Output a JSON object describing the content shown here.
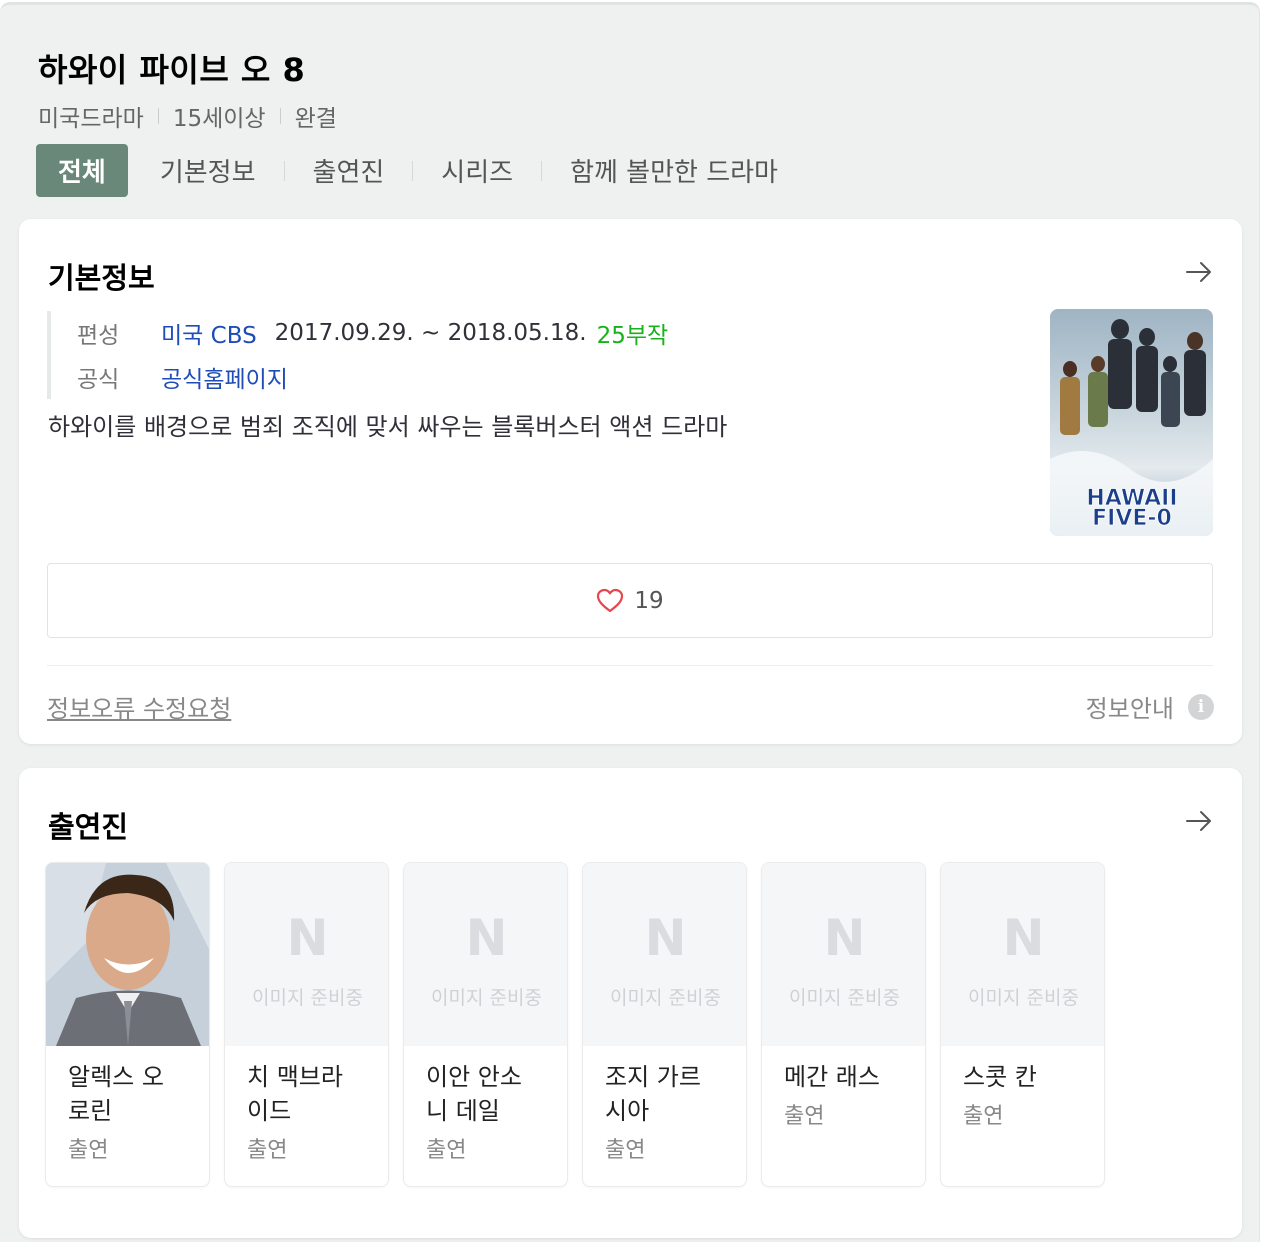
{
  "header": {
    "title": "하와이 파이브 오 8",
    "meta": [
      "미국드라마",
      "15세이상",
      "완결"
    ]
  },
  "tabs": [
    {
      "label": "전체",
      "active": true
    },
    {
      "label": "기본정보",
      "active": false
    },
    {
      "label": "출연진",
      "active": false
    },
    {
      "label": "시리즈",
      "active": false
    },
    {
      "label": "함께 볼만한 드라마",
      "active": false
    }
  ],
  "basic_info": {
    "title": "기본정보",
    "broadcast_label": "편성",
    "broadcast_channel": "미국 CBS",
    "broadcast_dates": "2017.09.29. ~ 2018.05.18.",
    "episodes": "25부작",
    "official_label": "공식",
    "official_link": "공식홈페이지",
    "description": "하와이를 배경으로 범죄 조직에 맞서 싸우는 블록버스터 액션 드라마",
    "poster_text": [
      "HAWAII",
      "FIVE-0"
    ],
    "like_count": "19",
    "report_link": "정보오류 수정요청",
    "guide_label": "정보안내",
    "guide_icon": "i"
  },
  "cast": {
    "title": "출연진",
    "placeholder_logo": "N",
    "placeholder_text": "이미지 준비중",
    "members": [
      {
        "name_lines": [
          "알렉스 오",
          "로린"
        ],
        "role": "출연",
        "has_photo": true
      },
      {
        "name_lines": [
          "치 맥브라",
          "이드"
        ],
        "role": "출연",
        "has_photo": false
      },
      {
        "name_lines": [
          "이안 안소",
          "니 데일"
        ],
        "role": "출연",
        "has_photo": false
      },
      {
        "name_lines": [
          "조지 가르",
          "시아"
        ],
        "role": "출연",
        "has_photo": false
      },
      {
        "name_lines": [
          "메간 래스"
        ],
        "role": "출연",
        "has_photo": false
      },
      {
        "name_lines": [
          "스콧 칸"
        ],
        "role": "출연",
        "has_photo": false
      }
    ]
  },
  "colors": {
    "active_tab": "#6a887a",
    "link_blue": "#1e4db7",
    "episodes_green": "#17b21c",
    "heart_red": "#e8464f"
  }
}
